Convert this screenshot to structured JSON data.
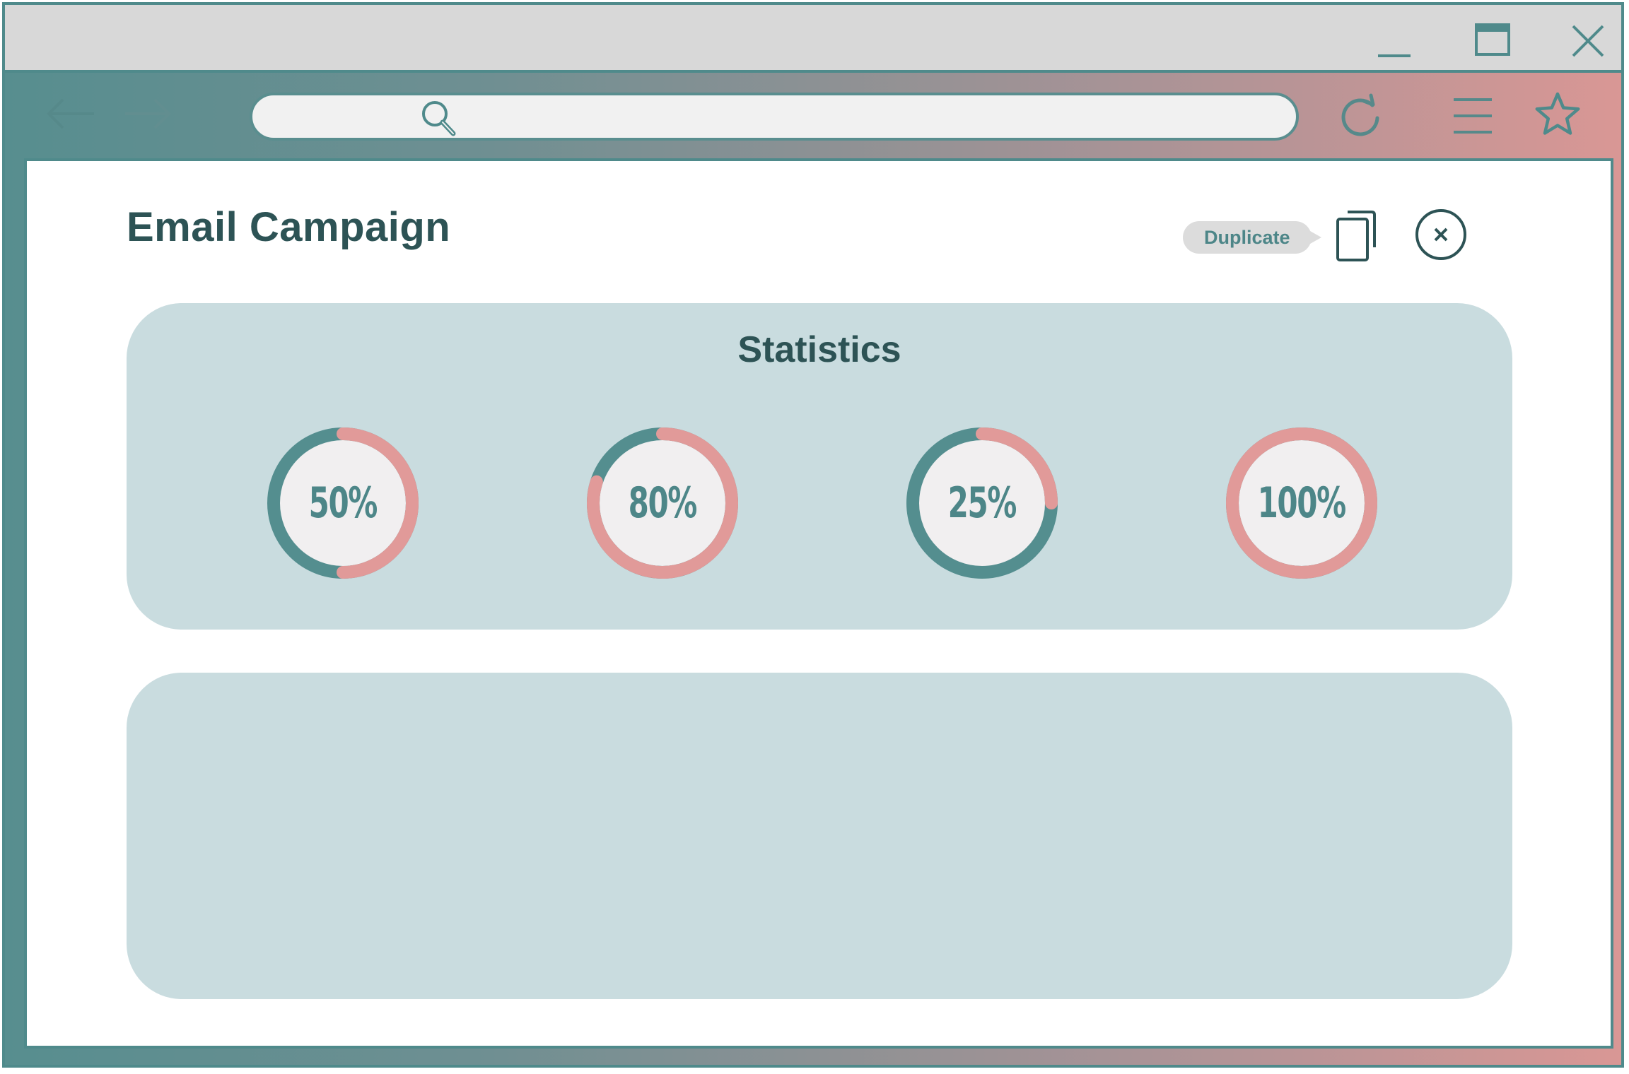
{
  "window": {
    "controls": [
      {
        "name": "minimize-icon"
      },
      {
        "name": "maximize-icon"
      },
      {
        "name": "close-icon"
      }
    ]
  },
  "nav": {
    "search": {
      "value": "",
      "placeholder": ""
    },
    "icons": [
      "back-arrow-icon",
      "forward-arrow-icon",
      "search-icon",
      "refresh-icon",
      "menu-icon",
      "star-icon"
    ]
  },
  "page": {
    "title": "Email Campaign",
    "tooltip": "Duplicate"
  },
  "statistics": {
    "title": "Statistics",
    "gauges": [
      {
        "label": "50%",
        "value": 0.5
      },
      {
        "label": "80%",
        "value": 0.8
      },
      {
        "label": "25%",
        "value": 0.25
      },
      {
        "label": "100%",
        "value": 1.0
      }
    ]
  },
  "colors": {
    "teal": "#548e8f",
    "pink": "#e19a99",
    "dark_text": "#2d5355",
    "panel_bg": "#c9dcdf",
    "gauge_center": "#f1eff0"
  }
}
